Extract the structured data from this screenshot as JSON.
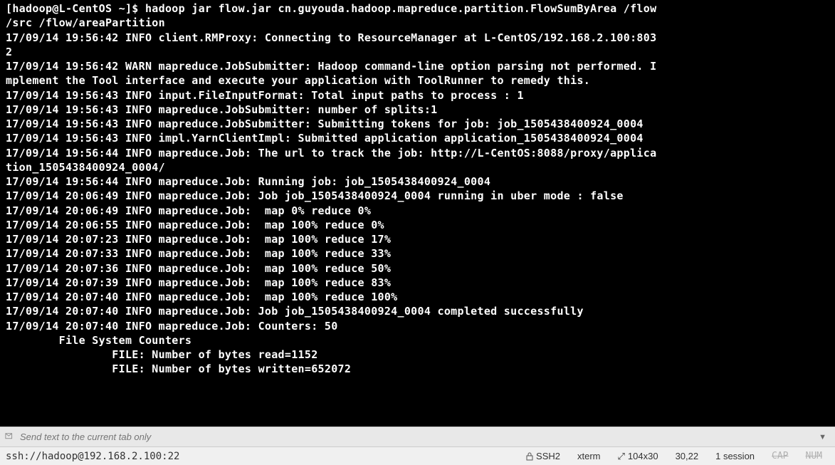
{
  "terminal": {
    "lines": [
      "[hadoop@L-CentOS ~]$ hadoop jar flow.jar cn.guyouda.hadoop.mapreduce.partition.FlowSumByArea /flow",
      "/src /flow/areaPartition",
      "17/09/14 19:56:42 INFO client.RMProxy: Connecting to ResourceManager at L-CentOS/192.168.2.100:803",
      "2",
      "17/09/14 19:56:42 WARN mapreduce.JobSubmitter: Hadoop command-line option parsing not performed. I",
      "mplement the Tool interface and execute your application with ToolRunner to remedy this.",
      "17/09/14 19:56:43 INFO input.FileInputFormat: Total input paths to process : 1",
      "17/09/14 19:56:43 INFO mapreduce.JobSubmitter: number of splits:1",
      "17/09/14 19:56:43 INFO mapreduce.JobSubmitter: Submitting tokens for job: job_1505438400924_0004",
      "17/09/14 19:56:43 INFO impl.YarnClientImpl: Submitted application application_1505438400924_0004",
      "17/09/14 19:56:44 INFO mapreduce.Job: The url to track the job: http://L-CentOS:8088/proxy/applica",
      "tion_1505438400924_0004/",
      "17/09/14 19:56:44 INFO mapreduce.Job: Running job: job_1505438400924_0004",
      "17/09/14 20:06:49 INFO mapreduce.Job: Job job_1505438400924_0004 running in uber mode : false",
      "17/09/14 20:06:49 INFO mapreduce.Job:  map 0% reduce 0%",
      "17/09/14 20:06:55 INFO mapreduce.Job:  map 100% reduce 0%",
      "17/09/14 20:07:23 INFO mapreduce.Job:  map 100% reduce 17%",
      "17/09/14 20:07:33 INFO mapreduce.Job:  map 100% reduce 33%",
      "17/09/14 20:07:36 INFO mapreduce.Job:  map 100% reduce 50%",
      "17/09/14 20:07:39 INFO mapreduce.Job:  map 100% reduce 83%",
      "17/09/14 20:07:40 INFO mapreduce.Job:  map 100% reduce 100%",
      "17/09/14 20:07:40 INFO mapreduce.Job: Job job_1505438400924_0004 completed successfully",
      "17/09/14 20:07:40 INFO mapreduce.Job: Counters: 50",
      "        File System Counters",
      "                FILE: Number of bytes read=1152",
      "                FILE: Number of bytes written=652072"
    ]
  },
  "inputbar": {
    "placeholder": "Send text to the current tab only"
  },
  "statusbar": {
    "connection": "ssh://hadoop@192.168.2.100:22",
    "protocol": "SSH2",
    "termtype": "xterm",
    "size": "104x30",
    "cursor": "30,22",
    "sessions": "1 session",
    "caps": "CAP",
    "num": "NUM"
  }
}
